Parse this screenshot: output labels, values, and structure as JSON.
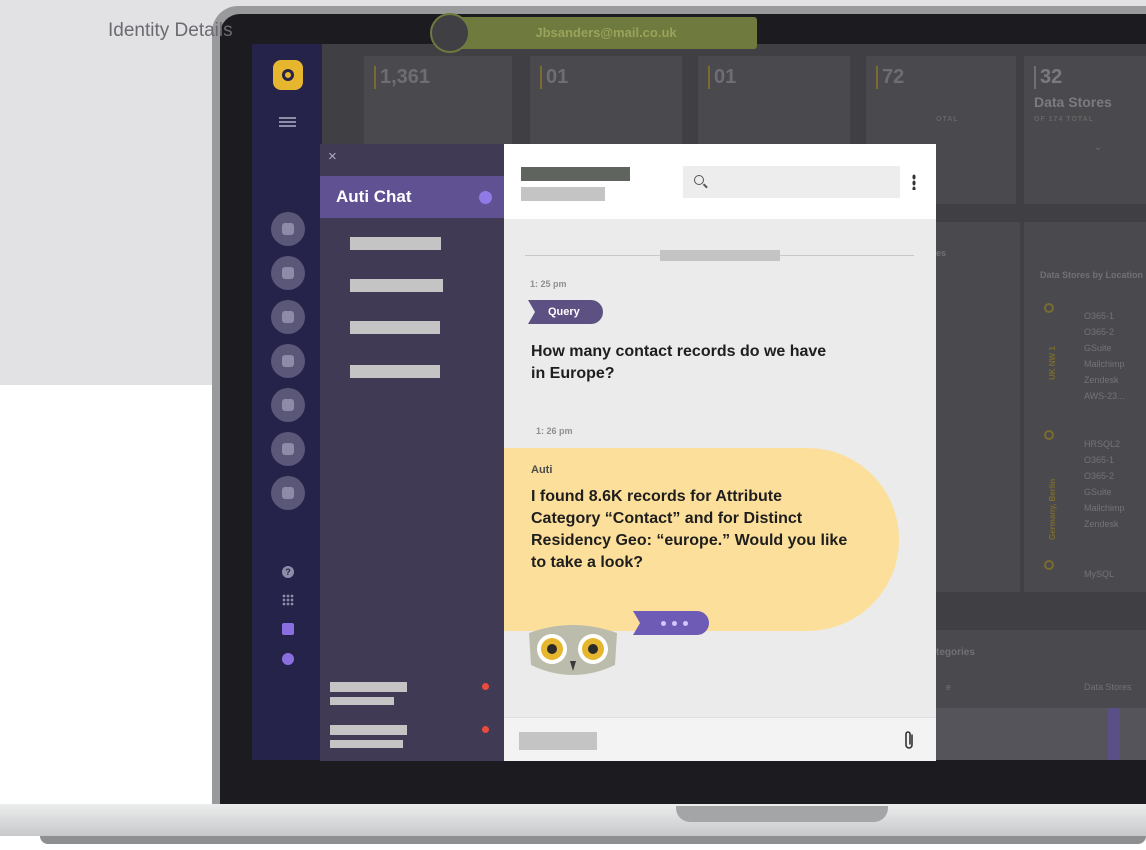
{
  "app": {
    "page_title": "Identity Details",
    "identity_email": "Jbsanders@mail.co.uk"
  },
  "stats": [
    {
      "value": "1,361"
    },
    {
      "value": "01"
    },
    {
      "value": "01"
    },
    {
      "value": "72"
    },
    {
      "value": "32",
      "label": "Data Stores",
      "sub": "OF 174 TOTAL"
    }
  ],
  "background_panels": {
    "locations_title": "Data Stores by Location",
    "location_groups": [
      {
        "location": "UK NW 1",
        "stores": [
          "O365-1",
          "O365-2",
          "GSuite",
          "Mailchimp",
          "Zendesk",
          "AWS-23..."
        ]
      },
      {
        "location": "Germany, Berlin",
        "stores": [
          "HRSQL2",
          "O365-1",
          "O365-2",
          "GSuite",
          "Mailchimp",
          "Zendesk"
        ]
      },
      {
        "location": "",
        "stores": [
          "MySQL"
        ]
      }
    ],
    "categories_title": "tegories",
    "categories_col2": "Data Stores",
    "partial_total": "OTAL",
    "partial_es": "es",
    "partial_e": "e"
  },
  "chat": {
    "side_title": "Auti Chat",
    "close_symbol": "×",
    "messages": [
      {
        "time": "1: 25 pm",
        "tag": "Query",
        "text": "How many contact records do we have in Europe?"
      },
      {
        "time": "1: 26 pm",
        "sender": "Auti",
        "text": "I found 8.6K records for Attribute Category “Contact” and for Distinct Residency Geo: “europe.” Would you like to take a look?"
      }
    ]
  },
  "colors": {
    "accent_purple": "#5f5192",
    "bubble_yellow": "#fcdf9a",
    "brand_yellow": "#e6b62e",
    "sidebar_navy": "#26234a",
    "unread_red": "#ea4c3c"
  }
}
